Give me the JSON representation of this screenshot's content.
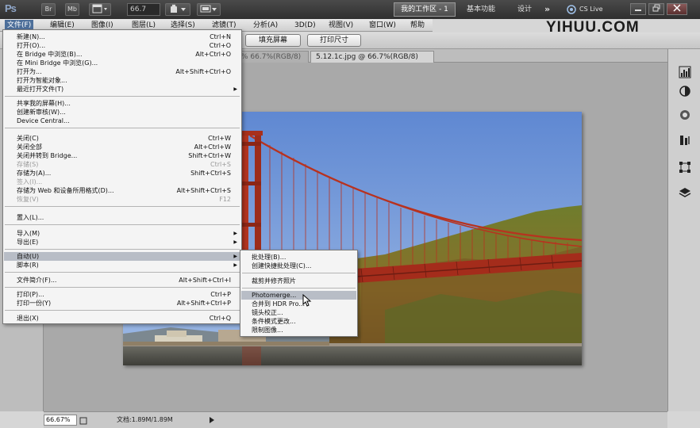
{
  "topbar": {
    "logo": "Ps",
    "br_label": "Br",
    "mb_label": "Mb",
    "zoom": "66.7",
    "workspaces": {
      "active": "我的工作区 - 1",
      "basic": "基本功能",
      "design": "设计",
      "more": "»"
    },
    "cslive": "CS Live"
  },
  "menubar": {
    "items": [
      "文件(F)",
      "编辑(E)",
      "图像(I)",
      "图层(L)",
      "选择(S)",
      "滤镜(T)",
      "分析(A)",
      "3D(D)",
      "视图(V)",
      "窗口(W)",
      "帮助(H)"
    ]
  },
  "brand": "YIHUU.COM",
  "options": {
    "fill_screen": "填充屏幕",
    "print_size": "打印尺寸"
  },
  "tabs": {
    "prev": "% 66.7%(RGB/8)",
    "active": "5.12.1c.jpg @ 66.7%(RGB/8)"
  },
  "status": {
    "zoom": "66.67%",
    "doc": "文档:1.89M/1.89M"
  },
  "file_menu": {
    "items": [
      {
        "label": "新建(N)...",
        "shortcut": "Ctrl+N"
      },
      {
        "label": "打开(O)...",
        "shortcut": "Ctrl+O"
      },
      {
        "label": "在 Bridge 中浏览(B)...",
        "shortcut": "Alt+Ctrl+O"
      },
      {
        "label": "在 Mini Bridge 中浏览(G)...",
        "shortcut": ""
      },
      {
        "label": "打开为...",
        "shortcut": "Alt+Shift+Ctrl+O"
      },
      {
        "label": "打开为智能对象...",
        "shortcut": ""
      },
      {
        "label": "最近打开文件(T)",
        "shortcut": ""
      },
      {
        "label": "共享我的屏幕(H)...",
        "shortcut": ""
      },
      {
        "label": "创建新审核(W)...",
        "shortcut": ""
      },
      {
        "label": "Device Central...",
        "shortcut": ""
      },
      {
        "label": "关闭(C)",
        "shortcut": "Ctrl+W"
      },
      {
        "label": "关闭全部",
        "shortcut": "Alt+Ctrl+W"
      },
      {
        "label": "关闭并转到 Bridge...",
        "shortcut": "Shift+Ctrl+W"
      },
      {
        "label": "存储(S)",
        "shortcut": "Ctrl+S"
      },
      {
        "label": "存储为(A)...",
        "shortcut": "Shift+Ctrl+S"
      },
      {
        "label": "签入(I)...",
        "shortcut": ""
      },
      {
        "label": "存储为 Web 和设备所用格式(D)...",
        "shortcut": "Alt+Shift+Ctrl+S"
      },
      {
        "label": "恢复(V)",
        "shortcut": "F12"
      },
      {
        "label": "置入(L)...",
        "shortcut": ""
      },
      {
        "label": "导入(M)",
        "shortcut": ""
      },
      {
        "label": "导出(E)",
        "shortcut": ""
      },
      {
        "label": "自动(U)",
        "shortcut": ""
      },
      {
        "label": "脚本(R)",
        "shortcut": ""
      },
      {
        "label": "文件简介(F)...",
        "shortcut": "Alt+Shift+Ctrl+I"
      },
      {
        "label": "打印(P)...",
        "shortcut": "Ctrl+P"
      },
      {
        "label": "打印一份(Y)",
        "shortcut": "Alt+Shift+Ctrl+P"
      },
      {
        "label": "退出(X)",
        "shortcut": "Ctrl+Q"
      }
    ]
  },
  "automate_menu": {
    "items": [
      "批处理(B)...",
      "创建快捷批处理(C)...",
      "裁剪并修齐照片",
      "Photomerge...",
      "合并到 HDR Pro...",
      "镜头校正...",
      "条件模式更改...",
      "限制图像..."
    ]
  },
  "colors": {
    "menu_highlight": "#b8bdc6",
    "menu_active": "#4d6f9a",
    "bridge_red": "#b8321f",
    "sky": "#6f96d8"
  }
}
